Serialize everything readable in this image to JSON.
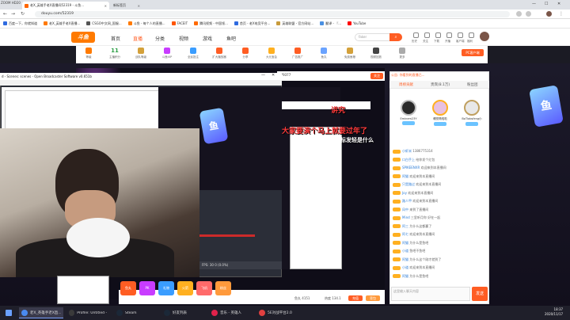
{
  "browser": {
    "camera_label": "ZOOM HD20",
    "tabs": [
      {
        "title": "老X_英雄手老X直播间52319 - 斗鱼..."
      },
      {
        "title": "新标签页"
      }
    ],
    "url": "douyu.com/52319",
    "bookmarks": [
      {
        "label": "百度一下，你就知道",
        "color": "#2f6be0"
      },
      {
        "label": "老X_英雄手老X直播...",
        "color": "#ff7a00"
      },
      {
        "label": "CSGO中文网_国服...",
        "color": "#555"
      },
      {
        "label": "斗鱼 - 每个人的直播...",
        "color": "#ff7a00"
      },
      {
        "label": "FACEIT",
        "color": "#ff5500"
      },
      {
        "label": "腾讯视频 - 中国领...",
        "color": "#ff6a00"
      },
      {
        "label": "首页 - 老X电竞平台...",
        "color": "#2f6be0"
      },
      {
        "label": "英雄联盟 - 官方网站...",
        "color": "#c89b3c"
      },
      {
        "label": "翻译 - 『...",
        "color": "#4a90e2"
      },
      {
        "label": "YouTube",
        "color": "#ff0000"
      }
    ]
  },
  "douyu": {
    "logo": "斗鱼",
    "nav": [
      {
        "label": "首页",
        "on": false
      },
      {
        "label": "直播",
        "on": true
      },
      {
        "label": "分类",
        "on": false
      },
      {
        "label": "视频",
        "on": false
      },
      {
        "label": "游戏",
        "on": false
      },
      {
        "label": "鱼吧",
        "on": false
      }
    ],
    "search_placeholder": "faker",
    "header_icons": [
      "历史",
      "关注",
      "下载",
      "开播",
      "客户端",
      "福利"
    ],
    "room_tools": [
      {
        "label": "等级",
        "color": "#ff7a00"
      },
      {
        "label": "11",
        "sub": "主播积分"
      },
      {
        "label": "战队等级",
        "color": "#d4a13a"
      },
      {
        "label": "斗鱼VIP",
        "color": "#c83cff"
      },
      {
        "label": "全民投注",
        "color": "#3a9dff"
      },
      {
        "label": "扩大播放器",
        "color": "#ff5d23"
      },
      {
        "label": "分享",
        "color": "#ff5d23"
      },
      {
        "label": "大元宝会",
        "color": "#ffb020"
      },
      {
        "label": "广告推广",
        "color": "#ff5d23"
      },
      {
        "label": "鱼丸",
        "color": "#6aa3ff"
      },
      {
        "label": "免费鱼粮",
        "color": "#d4a13a"
      },
      {
        "label": "视频回放",
        "color": "#444"
      },
      {
        "label": "更多",
        "color": "#aaa"
      }
    ],
    "pc_button": "PC客户端",
    "follow_label": "关注",
    "room_id": "879377",
    "nest_lines": [
      "讲究",
      "大家要演个马上就要过年了",
      "标发轻是什么",
      "点击关注，别错过",
      "为什么"
    ],
    "chat": {
      "header_link": "公告: 你看到的直播已...",
      "tabs": [
        {
          "label": "周榜贡献",
          "on": true
        },
        {
          "label": "贵宾(8.1万)",
          "on": false
        },
        {
          "label": "粉丝团",
          "on": false
        }
      ],
      "ranks": [
        {
          "name": "Eminem23Y",
          "color": "#333"
        },
        {
          "name": "睡觉噜啦啦",
          "color": "#e0a4d8"
        },
        {
          "name": "BoTlabsfeng小",
          "color": "#ddd"
        }
      ],
      "lines": [
        {
          "name": "小虾米",
          "text": "1386775314"
        },
        {
          "name": "口白手上",
          "text": "给你发个红包"
        },
        {
          "name": "SPIKEENXR",
          "text": "欢迎来到本直播间"
        },
        {
          "name": "阿猫",
          "text": "欢迎来到本直播间"
        },
        {
          "name": "只是路过",
          "text": "欢迎来到本直播间"
        },
        {
          "name": "Joy",
          "text": "欢迎来到本直播间"
        },
        {
          "name": "路人甲",
          "text": "欢迎来到本直播间"
        },
        {
          "name": "风中",
          "text": "来到了直播间"
        },
        {
          "name": "Mind",
          "text": "三里听月你 好在一起"
        },
        {
          "name": "阿三",
          "text": "为什么这都赢了"
        },
        {
          "name": "阿七",
          "text": "欢迎来到本直播间"
        },
        {
          "name": "阿猫",
          "text": "为什么是鱼吧"
        },
        {
          "name": "小道",
          "text": "鱼吧不鱼吧"
        },
        {
          "name": "阿猫",
          "text": "为什么这个刚才就到了"
        },
        {
          "name": "小道",
          "text": "欢迎来到本直播间"
        },
        {
          "name": "阿猫",
          "text": "为什么是鱼吧"
        }
      ],
      "input_placeholder": "这里输入聊天内容",
      "send_label": "发送"
    },
    "player_bottom": {
      "gifts": [
        {
          "label": "鱼丸",
          "color": "#ff5d23"
        },
        {
          "label": "PK",
          "color": "#c83cff"
        },
        {
          "label": "礼物",
          "color": "#3a9dff"
        },
        {
          "label": "火箭",
          "color": "#ffb020"
        },
        {
          "label": "飞机",
          "color": "#ff6a6a"
        },
        {
          "label": "粉丝",
          "color": "#ff9a3c"
        }
      ],
      "viewer_text": "鱼丸 4151",
      "hot_text": "热度 134.1",
      "recharge": "充值",
      "gift_btn": "背包"
    }
  },
  "obs": {
    "title": "d - Scenes: scenes - Open Broadcaster Software v0.651b",
    "status": "FPS: 30  0 (0.0%)"
  },
  "taskbar": {
    "items": [
      {
        "label": "老X_英雄手老X直...",
        "color": "#4a8af0",
        "on": true
      },
      {
        "label": "Profile: Untitled - ...",
        "color": "#3a3a3a",
        "on": false
      },
      {
        "label": "Steam",
        "color": "#1b2838",
        "on": false
      },
      {
        "label": "好友列表",
        "color": "#1b2838",
        "on": false
      },
      {
        "label": "音乐 - 英雄人",
        "color": "#e0224b",
        "on": false
      },
      {
        "label": "5E对战平台2.0",
        "color": "#e04040",
        "on": false
      }
    ],
    "time": "18:37",
    "date": "2020/11/17"
  }
}
